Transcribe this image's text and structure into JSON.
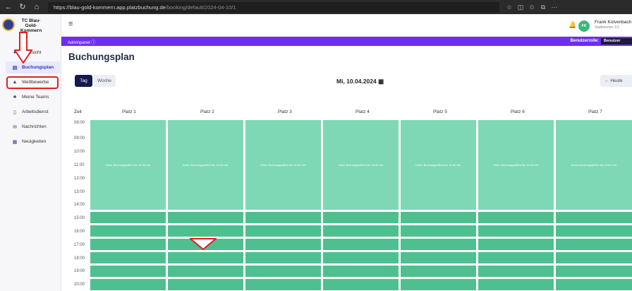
{
  "browser": {
    "url_host": "https://blau-gold-kommern.app.platzbuchung.de",
    "url_path": "/booking/default/2024-04-10/1"
  },
  "sidebar": {
    "logo_text": "TC Blau-Gold-Kommern",
    "items": [
      {
        "label": "Übersicht",
        "icon": "home-icon"
      },
      {
        "label": "Buchungsplan",
        "icon": "calendar-icon"
      },
      {
        "label": "Wettbewerbe",
        "icon": "trophy-icon"
      },
      {
        "label": "Meine Teams",
        "icon": "team-icon"
      },
      {
        "label": "Arbeitsdienst",
        "icon": "document-icon"
      },
      {
        "label": "Nachrichten",
        "icon": "mail-icon"
      },
      {
        "label": "Neuigkeiten",
        "icon": "news-icon"
      }
    ]
  },
  "header": {
    "avatar_initials": "FK",
    "user_name": "Frank Kolvenbach",
    "user_sub": "Stadtwerten 1/1",
    "adminpanel": "Adminpanel ⓘ",
    "role_label": "Benutzerrolle:",
    "role_value": "Benutzer"
  },
  "page": {
    "title": "Buchungsplan",
    "view_day": "Tag",
    "view_week": "Woche",
    "date": "Mi, 10.04.2024",
    "today": "Heute"
  },
  "grid": {
    "time_header": "Zeit",
    "courts": [
      "Platz 1",
      "Platz 2",
      "Platz 3",
      "Platz 4",
      "Platz 5",
      "Platz 6",
      "Platz 7"
    ],
    "times": [
      "08:00",
      "09:00",
      "10:00",
      "11:00",
      "12:00",
      "13:00",
      "14:00",
      "15:00",
      "16:00",
      "17:00",
      "18:00",
      "19:00",
      "20:00"
    ],
    "block_text": "Keine Buchungspflicht bis 15:00 Uhr"
  },
  "colors": {
    "accent": "#6e2ef2",
    "block": "#7ed8b5",
    "slot": "#4ec08f",
    "annotation": "#e02020"
  }
}
